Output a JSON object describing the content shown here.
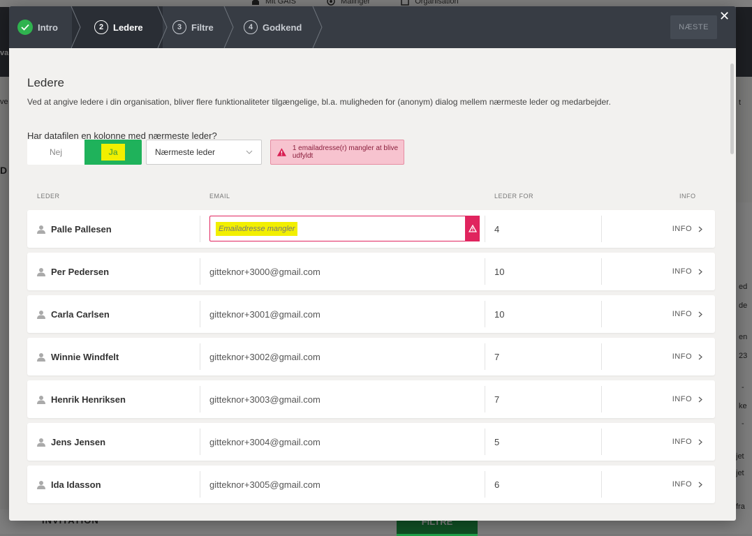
{
  "background": {
    "topnav": [
      "Mit GAIS",
      "Målinger",
      "Organisation"
    ],
    "invitation_label": "INVITATION",
    "filtre_label": "FILTRE",
    "left_fragments": [
      "va",
      "ve",
      "D"
    ],
    "right_fragments": [
      "t",
      "ed",
      "de",
      "en",
      "23",
      "-",
      "ke",
      "-",
      "jet",
      "jet",
      "fra"
    ]
  },
  "header": {
    "steps": [
      {
        "number": "",
        "label": "Intro",
        "state": "done"
      },
      {
        "number": "2",
        "label": "Ledere",
        "state": "active"
      },
      {
        "number": "3",
        "label": "Filtre",
        "state": "pending"
      },
      {
        "number": "4",
        "label": "Godkend",
        "state": "pending"
      }
    ],
    "next_label": "NÆSTE",
    "close_icon": "close-icon"
  },
  "content": {
    "title": "Ledere",
    "description": "Ved at angive ledere i din organisation, bliver flere funktionaliteter tilgængelige, bl.a. muligheden for (anonym) dialog mellem nærmeste leder og medarbejder.",
    "question": "Har datafilen en kolonne med nærmeste leder?",
    "toggle": {
      "no_label": "Nej",
      "yes_label": "Ja",
      "selected": "Ja"
    },
    "column_select": {
      "value": "Nærmeste leder"
    },
    "alert": {
      "text": "1 emailadresse(r) mangler at blive udfyldt",
      "color": "#e0245e"
    }
  },
  "table": {
    "headers": {
      "leader": "LEDER",
      "email": "EMAIL",
      "leader_for": "LEDER FOR",
      "info": "INFO"
    },
    "rows": [
      {
        "name": "Palle Pallesen",
        "email": "",
        "email_placeholder": "Emailadresse mangler",
        "leader_for": "4",
        "info": "INFO"
      },
      {
        "name": "Per Pedersen",
        "email": "gitteknor+3000@gmail.com",
        "leader_for": "10",
        "info": "INFO"
      },
      {
        "name": "Carla Carlsen",
        "email": "gitteknor+3001@gmail.com",
        "leader_for": "10",
        "info": "INFO"
      },
      {
        "name": "Winnie Windfelt",
        "email": "gitteknor+3002@gmail.com",
        "leader_for": "7",
        "info": "INFO"
      },
      {
        "name": "Henrik Henriksen",
        "email": "gitteknor+3003@gmail.com",
        "leader_for": "7",
        "info": "INFO"
      },
      {
        "name": "Jens Jensen",
        "email": "gitteknor+3004@gmail.com",
        "leader_for": "5",
        "info": "INFO"
      },
      {
        "name": "Ida Idasson",
        "email": "gitteknor+3005@gmail.com",
        "leader_for": "6",
        "info": "INFO"
      }
    ]
  },
  "colors": {
    "accent_green": "#1fb25b",
    "header_dark": "#373c44",
    "error": "#e0245e",
    "highlight": "#f2ef00"
  }
}
